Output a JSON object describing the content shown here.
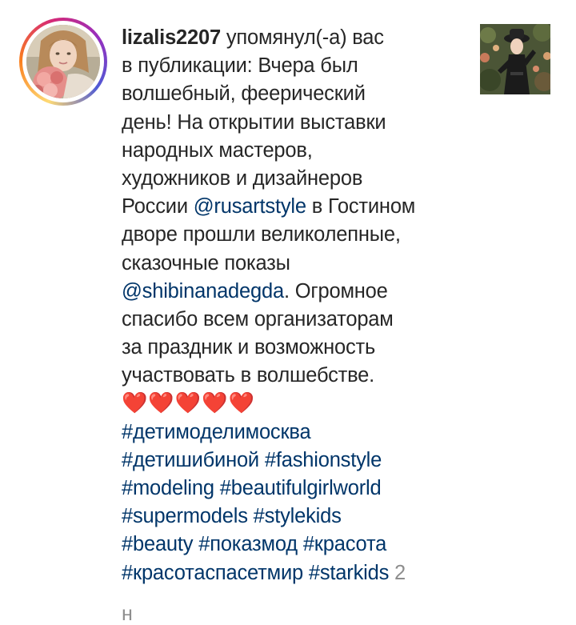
{
  "notification": {
    "username": "lizalis2207",
    "action": " упомянул(-а) вас",
    "lines": [
      "в публикации: Вчера был",
      "волшебный, феерический",
      "день!  На открытии выставки",
      "народных мастеров,",
      "художников и дизайнеров"
    ],
    "russia_prefix": "России ",
    "mention_1": "@rusartstyle",
    "russia_suffix": " в Гостином",
    "line_dvor": "дворе прошли великолепные,",
    "line_skaz": "сказочные показы",
    "mention_2": "@shibinanadegda",
    "mention_2_suffix": ". Огромное",
    "line_spas": "спасибо всем организаторам",
    "line_prazd": "за праздник и возможность",
    "line_uch": "участвовать в волшебстве.",
    "hearts": "❤️❤️❤️❤️❤️",
    "hashtags_line_1": "#детимоделимосква",
    "hashtags_line_2": "#детишибиной #fashionstyle",
    "hashtags_line_3": "#modeling #beautifulgirlworld",
    "hashtags_line_4": "#supermodels #stylekids",
    "hashtags_line_5": "#beauty #показмод #красота",
    "hashtags_line_6": "#красотаспасетмир #starkids",
    "timestamp": " 2",
    "timestamp_unit_partial": "н"
  },
  "colors": {
    "text": "#262626",
    "link": "#003569",
    "meta": "#8e8e8e",
    "heart": "#e0182d",
    "story_ring": [
      "#feda75",
      "#fa7e1e",
      "#d62976",
      "#962fbf",
      "#4f5bd5"
    ]
  },
  "icons": {
    "avatar": "user-avatar-photo",
    "post": "post-thumbnail-photo"
  }
}
